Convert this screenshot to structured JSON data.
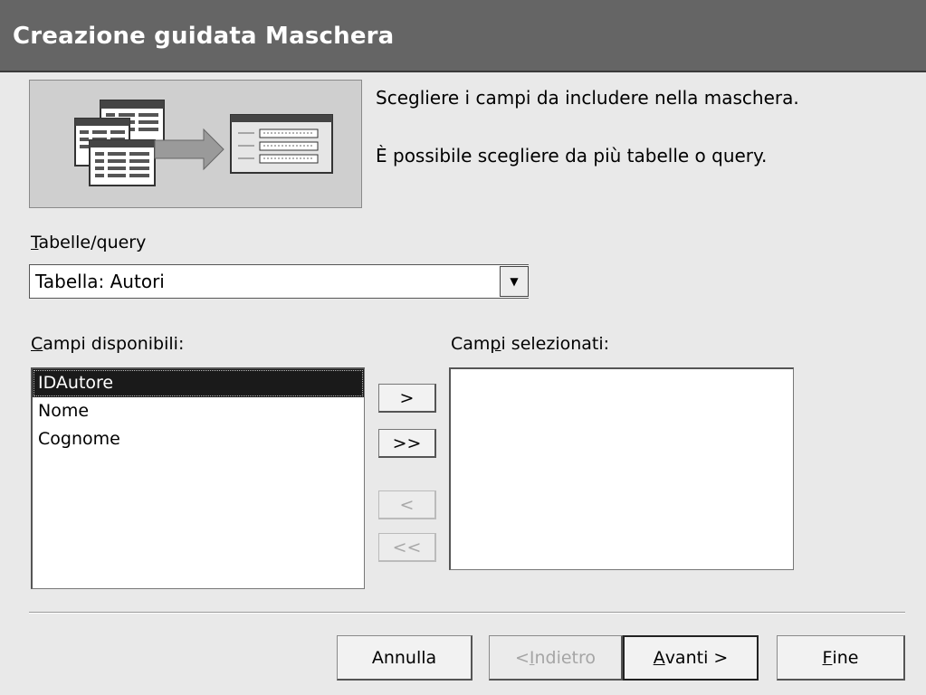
{
  "dialog": {
    "title": "Creazione guidata Maschera"
  },
  "intro": {
    "line1": "Scegliere i campi da includere nella maschera.",
    "line2": "È possibile scegliere da più tabelle o query."
  },
  "tables": {
    "label_accel": "T",
    "label_rest": "abelle/query",
    "selected": "Tabella: Autori",
    "arrow_icon": "dropdown-arrow-icon"
  },
  "available": {
    "label_accel": "C",
    "label_rest": "ampi disponibili:",
    "items": [
      "IDAutore",
      "Nome",
      "Cognome"
    ],
    "selected_index": 0
  },
  "selected_fields": {
    "label_pre": "Cam",
    "label_accel": "p",
    "label_post": "i selezionati:",
    "items": []
  },
  "move_buttons": {
    "add_one": ">",
    "add_all": ">>",
    "remove_one": "<",
    "remove_all": "<<"
  },
  "footer": {
    "cancel": "Annulla",
    "back_pre": "< ",
    "back_accel": "I",
    "back_rest": "ndietro",
    "next_accel": "A",
    "next_rest": "vanti >",
    "finish_accel": "F",
    "finish_rest": "ine"
  },
  "colors": {
    "titlebar": "#656565",
    "selection": "#1a1a1a"
  }
}
